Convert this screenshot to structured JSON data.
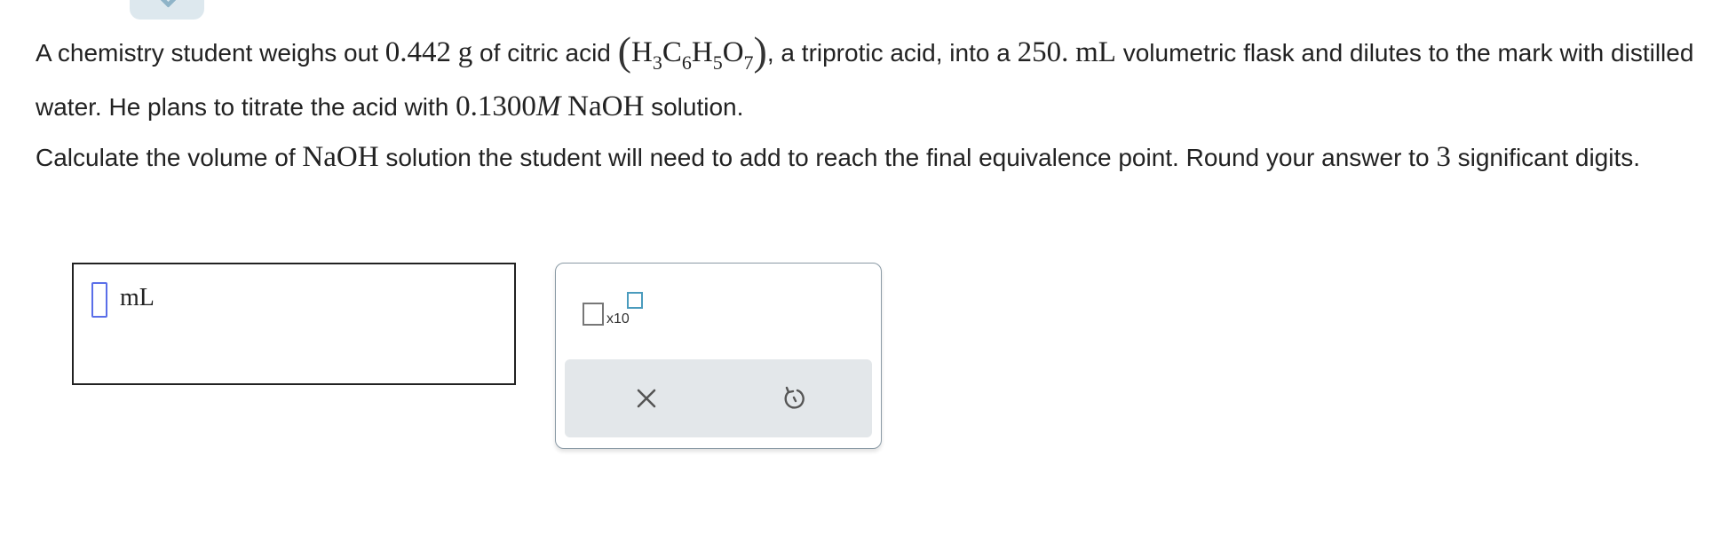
{
  "question": {
    "p1": {
      "t1": "A chemistry student weighs out ",
      "mass": "0.442",
      "mass_unit": "g",
      "t2": " of citric acid ",
      "formula": {
        "open": "(",
        "parts": [
          {
            "el": "H",
            "sub": "3"
          },
          {
            "el": "C",
            "sub": "6"
          },
          {
            "el": "H",
            "sub": "5"
          },
          {
            "el": "O",
            "sub": "7"
          }
        ],
        "close": ")"
      },
      "t3": ", a triprotic acid, into a ",
      "vol": "250.",
      "vol_unit": "mL",
      "t4": " volumetric flask and dilutes to the mark with distilled water. He plans to titrate the acid with ",
      "conc": "0.1300",
      "conc_unit": "M",
      "base": "NaOH",
      "t5": " solution."
    },
    "p2": {
      "t1": "Calculate the volume of ",
      "base": "NaOH",
      "t2": " solution the student will need to add to reach the final equivalence point. Round your answer to ",
      "digits": "3",
      "t3": " significant digits."
    }
  },
  "answer": {
    "value": "",
    "unit": "mL"
  },
  "toolbox": {
    "sci_notation_label": "x10",
    "clear_icon": "close-icon",
    "undo_icon": "undo-icon"
  },
  "colors": {
    "caret": "#5a6ee8",
    "exponent_box": "#4a9bbd",
    "toolbar_bg": "#e3e7ea",
    "tab_bg": "#dde8ee"
  }
}
